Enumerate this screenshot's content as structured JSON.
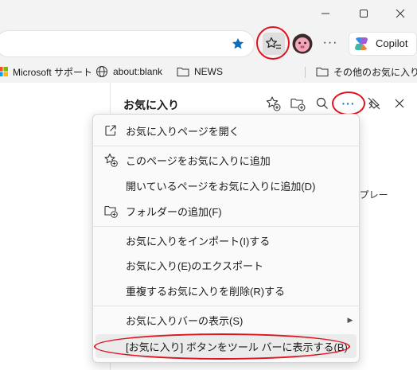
{
  "window": {
    "minimize_icon": "minimize-icon",
    "maximize_icon": "maximize-icon",
    "close_icon": "close-icon"
  },
  "toolbar": {
    "copilot_label": "Copilot",
    "more_label": "···"
  },
  "favorites_bar": {
    "items": [
      {
        "label": "Microsoft サポート",
        "icon": "microsoft-logo-icon"
      },
      {
        "label": "about:blank",
        "icon": "globe-icon"
      },
      {
        "label": "NEWS",
        "icon": "folder-icon"
      }
    ],
    "other_label": "その他のお気に入り"
  },
  "hub": {
    "title": "お気に入り",
    "more_label": "···",
    "behind_text": "ンプレー"
  },
  "menu": {
    "items": [
      {
        "label": "お気に入りページを開く",
        "icon": "open-external-icon"
      },
      {
        "label": "このページをお気に入りに追加",
        "icon": "star-add-icon"
      },
      {
        "label": "開いているページをお気に入りに追加(D)",
        "icon": ""
      },
      {
        "label": "フォルダーの追加(F)",
        "icon": "folder-add-icon"
      },
      {
        "label": "お気に入りをインポート(I)する",
        "icon": ""
      },
      {
        "label": "お気に入り(E)のエクスポート",
        "icon": ""
      },
      {
        "label": "重複するお気に入りを削除(R)する",
        "icon": ""
      },
      {
        "label": "お気に入りバーの表示(S)",
        "icon": "chevron-right-icon"
      },
      {
        "label": "[お気に入り] ボタンをツール バーに表示する(B)",
        "icon": ""
      }
    ]
  },
  "colors": {
    "accent": "#0f6cbd",
    "annotation": "#e0141e"
  }
}
